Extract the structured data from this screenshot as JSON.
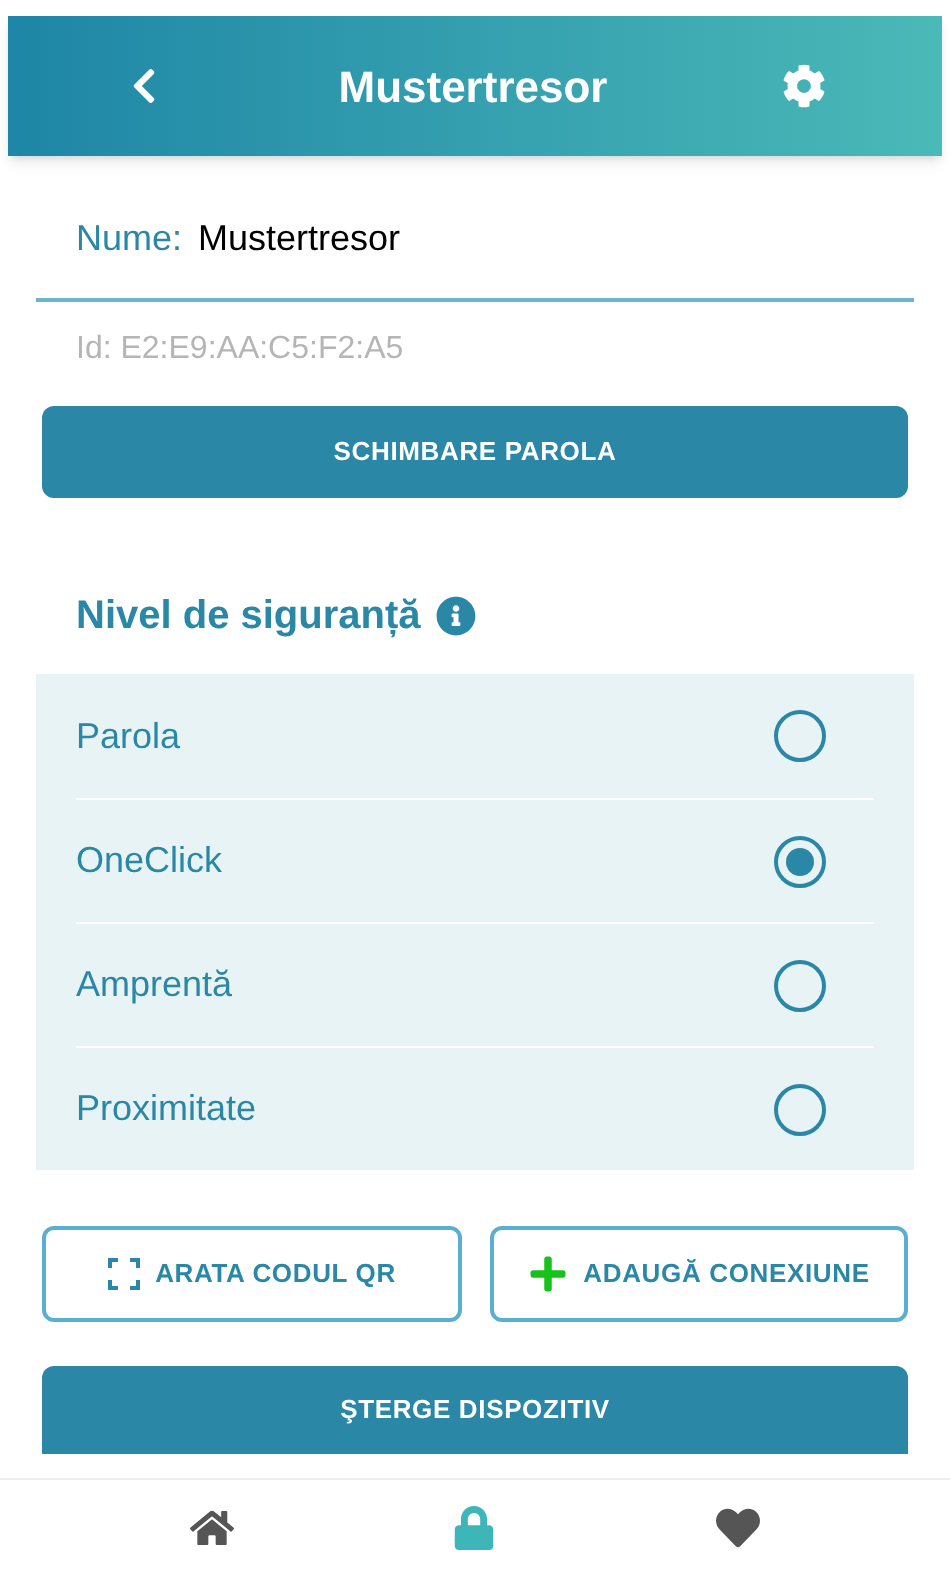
{
  "header": {
    "title": "Mustertresor"
  },
  "name_field": {
    "label": "Nume:",
    "value": "Mustertresor"
  },
  "id_text": "Id: E2:E9:AA:C5:F2:A5",
  "change_password_button": "SCHIMBARE PAROLA",
  "security": {
    "title": "Nivel de siguranță",
    "options": [
      {
        "label": "Parola",
        "selected": false
      },
      {
        "label": "OneClick",
        "selected": true
      },
      {
        "label": "Amprentă",
        "selected": false
      },
      {
        "label": "Proximitate",
        "selected": false
      }
    ]
  },
  "actions": [
    {
      "kind": "qr",
      "label": "ARATA CODUL QR"
    },
    {
      "kind": "add",
      "label": "ADAUGĂ CONEXIUNE"
    }
  ],
  "delete_button": "ŞTERGE DISPOZITIV",
  "bottom_nav": [
    {
      "kind": "home",
      "selected": false
    },
    {
      "kind": "lock",
      "selected": true
    },
    {
      "kind": "heart",
      "selected": false
    }
  ]
}
